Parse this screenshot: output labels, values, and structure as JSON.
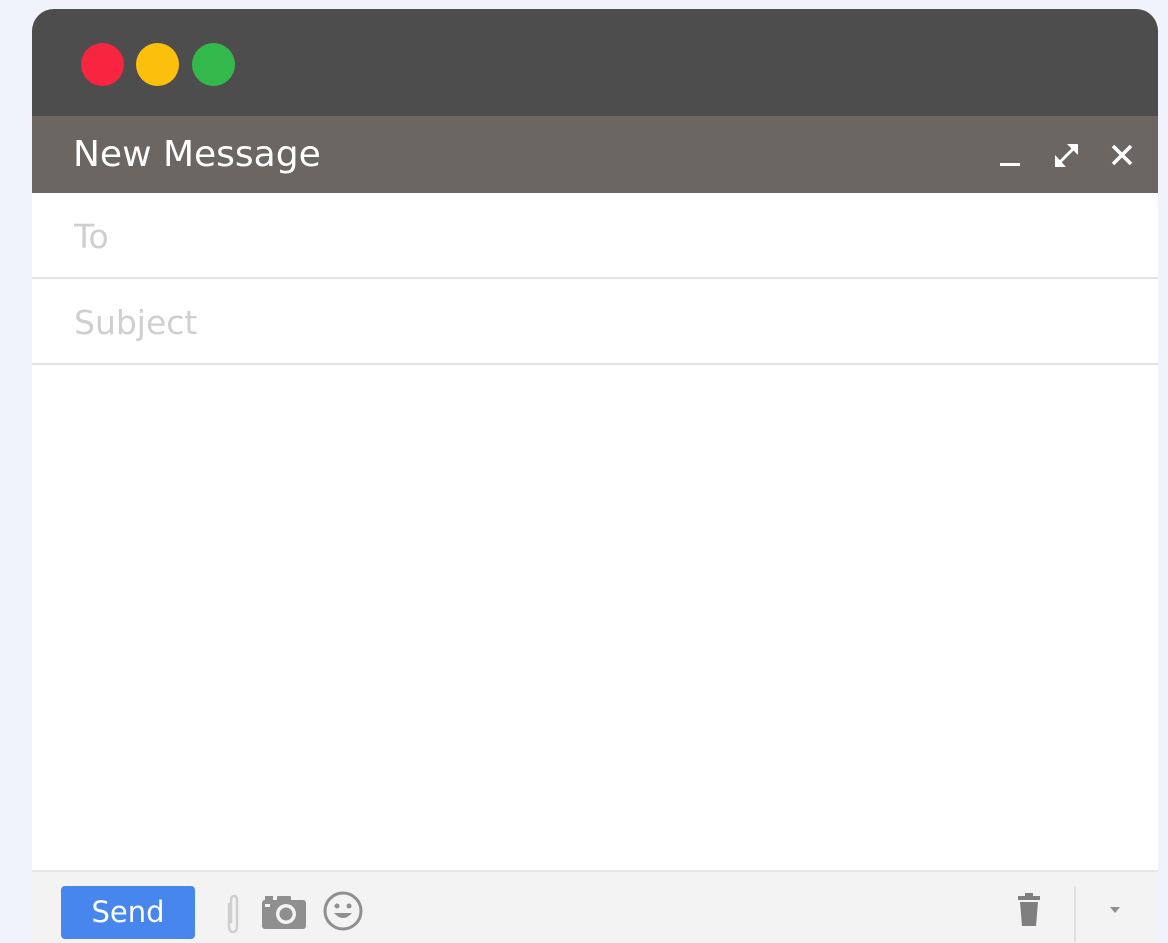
{
  "window": {
    "controls": [
      "close-dot",
      "minimize-dot",
      "zoom-dot"
    ],
    "colors": {
      "close": "#f7253f",
      "minimize": "#fbbf0c",
      "zoom": "#33b94b"
    }
  },
  "compose": {
    "title": "New Message",
    "header_actions": [
      "minimize-icon",
      "expand-icon",
      "close-icon"
    ],
    "to_placeholder": "To",
    "subject_placeholder": "Subject",
    "to_value": "",
    "subject_value": "",
    "body_value": ""
  },
  "toolbar": {
    "send_label": "Send",
    "send_color": "#4787ed",
    "icons": [
      "paperclip-icon",
      "camera-icon",
      "emoji-icon",
      "trash-icon",
      "dropdown-arrow-icon"
    ]
  }
}
